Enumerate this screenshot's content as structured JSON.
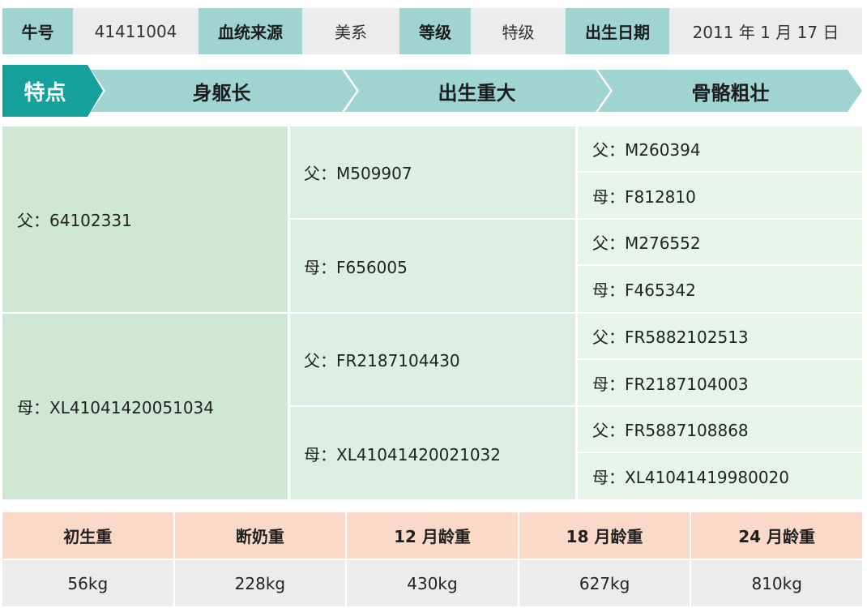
{
  "info": {
    "id_label": "牛号",
    "id_value": "41411004",
    "source_label": "血统来源",
    "source_value": "美系",
    "grade_label": "等级",
    "grade_value": "特级",
    "birth_label": "出生日期",
    "birth_value": "2011 年 1 月 17 日"
  },
  "features": {
    "title": "特点",
    "items": [
      "身躯长",
      "出生重大",
      "骨骼粗壮"
    ]
  },
  "colors": {
    "teal": "#16a09b",
    "light_teal": "#9fd4d1",
    "peach": "#fbd9c8",
    "gray": "#ececec",
    "green1": "#cfe8d6",
    "green2": "#dcefe2",
    "green3": "#e6f4ea"
  },
  "pedigree": {
    "sire": "父：64102331",
    "dam": "母：XL41041420051034",
    "sire_sire": "父：M509907",
    "sire_dam": "母：F656005",
    "dam_sire": "父：FR2187104430",
    "dam_dam": "母：XL41041420021032",
    "ggp": [
      "父：M260394",
      "母：F812810",
      "父：M276552",
      "母：F465342",
      "父：FR5882102513",
      "母：FR2187104003",
      "父：FR5887108868",
      "母：XL41041419980020"
    ]
  },
  "weights": {
    "headers": [
      "初生重",
      "断奶重",
      "12 月龄重",
      "18 月龄重",
      "24 月龄重"
    ],
    "values": [
      "56kg",
      "228kg",
      "430kg",
      "627kg",
      "810kg"
    ]
  }
}
